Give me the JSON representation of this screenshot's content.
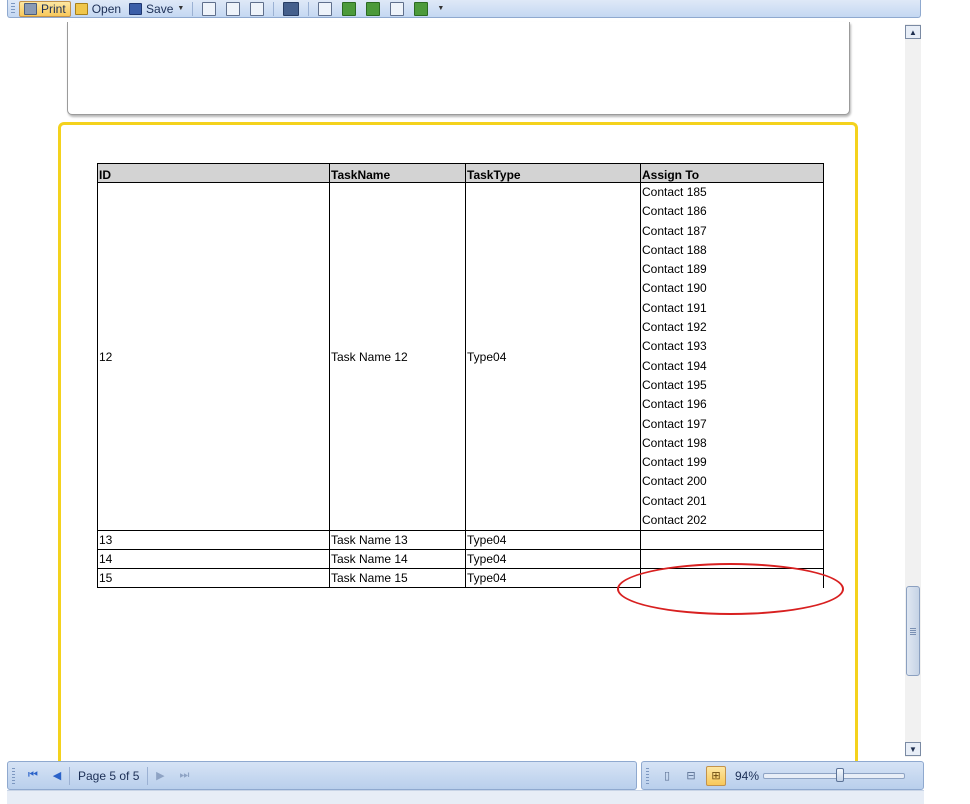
{
  "toolbar": {
    "print_label": "Print",
    "open_label": "Open",
    "save_label": "Save"
  },
  "table": {
    "headers": [
      "ID",
      "TaskName",
      "TaskType",
      "Assign To"
    ],
    "group_row": {
      "id": "12",
      "name": "Task Name 12",
      "type": "Type04",
      "contacts": [
        "Contact 185",
        "Contact 186",
        "Contact 187",
        "Contact 188",
        "Contact 189",
        "Contact 190",
        "Contact 191",
        "Contact 192",
        "Contact 193",
        "Contact 194",
        "Contact 195",
        "Contact 196",
        "Contact 197",
        "Contact 198",
        "Contact 199",
        "Contact 200",
        "Contact 201",
        "Contact 202"
      ]
    },
    "rows": [
      {
        "id": "13",
        "name": "Task Name 13",
        "type": "Type04"
      },
      {
        "id": "14",
        "name": "Task Name 14",
        "type": "Type04"
      },
      {
        "id": "15",
        "name": "Task Name 15",
        "type": "Type04"
      }
    ]
  },
  "statusbar": {
    "page_label": "Page 5 of 5",
    "zoom_label": "94%",
    "zoom_level_percent": 94
  },
  "colors": {
    "page_highlight": "#f4d21d",
    "annotation": "#d82020"
  }
}
